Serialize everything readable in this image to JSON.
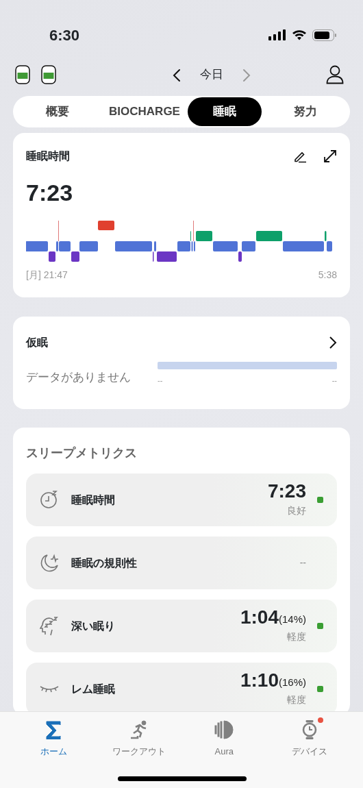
{
  "status_bar": {
    "time": "6:30"
  },
  "header": {
    "date": "今日",
    "prev_enabled": true,
    "next_enabled": false
  },
  "tabs": [
    {
      "label": "概要",
      "selected": false
    },
    {
      "label": "BIOCHARGE",
      "selected": false
    },
    {
      "label": "睡眠",
      "selected": true
    },
    {
      "label": "努力",
      "selected": false
    }
  ],
  "sleep_card": {
    "title": "睡眠時間",
    "duration": "7:23",
    "start": "[月] 21:47",
    "end": "5:38"
  },
  "nap_card": {
    "title": "仮眠",
    "message": "データがありません",
    "range_start": "--",
    "range_end": "--"
  },
  "metrics": {
    "title": "スリープメトリクス",
    "items": [
      {
        "kind": "duration",
        "label": "睡眠時間",
        "value": "7:23",
        "rating": "良好",
        "color": "#3a9e33"
      },
      {
        "kind": "regularity",
        "label": "睡眠の規則性",
        "value": "--"
      },
      {
        "kind": "deep",
        "label": "深い眠り",
        "value": "1:04",
        "percent": "(14%)",
        "rating": "軽度",
        "color": "#3a9e33"
      },
      {
        "kind": "rem",
        "label": "レム睡眠",
        "value": "1:10",
        "percent": "(16%)",
        "rating": "軽度",
        "color": "#3a9e33"
      }
    ]
  },
  "nav": [
    {
      "kind": "home",
      "label": "ホーム",
      "selected": true,
      "notification": false
    },
    {
      "kind": "workout",
      "label": "ワークアウト",
      "selected": false,
      "notification": false
    },
    {
      "kind": "aura",
      "label": "Aura",
      "selected": false,
      "notification": false
    },
    {
      "kind": "device",
      "label": "デバイス",
      "selected": false,
      "notification": true
    }
  ]
}
